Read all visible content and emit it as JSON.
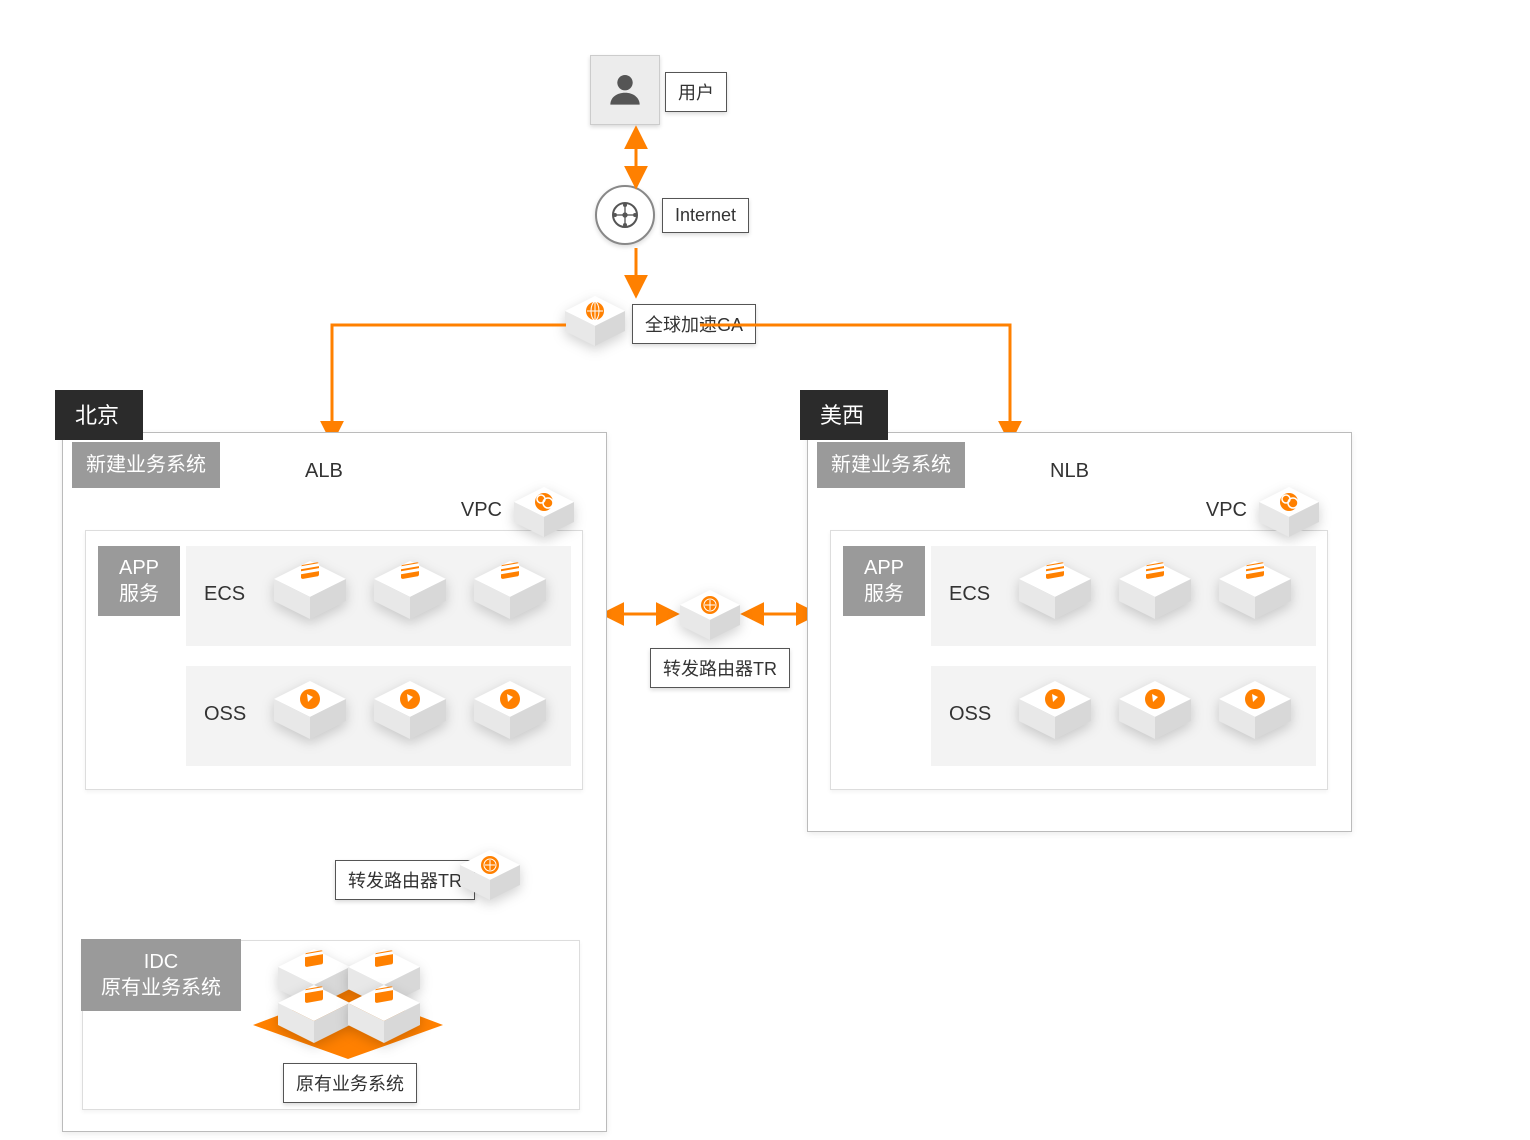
{
  "top": {
    "user_label": "用户",
    "internet_label": "Internet",
    "ga_label": "全球加速GA"
  },
  "center": {
    "tr_label": "转发路由器TR"
  },
  "beijing": {
    "tab": "北京",
    "new_system": "新建业务系统",
    "alb": "ALB",
    "vpc": "VPC",
    "app_service": "APP\n服务",
    "ecs": "ECS",
    "oss": "OSS",
    "tr_label": "转发路由器TR",
    "idc_label": "IDC\n原有业务系统",
    "legacy_system": "原有业务系统"
  },
  "uswest": {
    "tab": "美西",
    "new_system": "新建业务系统",
    "nlb": "NLB",
    "vpc": "VPC",
    "app_service": "APP\n服务",
    "ecs": "ECS",
    "oss": "OSS"
  },
  "colors": {
    "accent": "#ff8000",
    "region_tab": "#2b2b2b",
    "gray_label": "#9a9a9a"
  }
}
